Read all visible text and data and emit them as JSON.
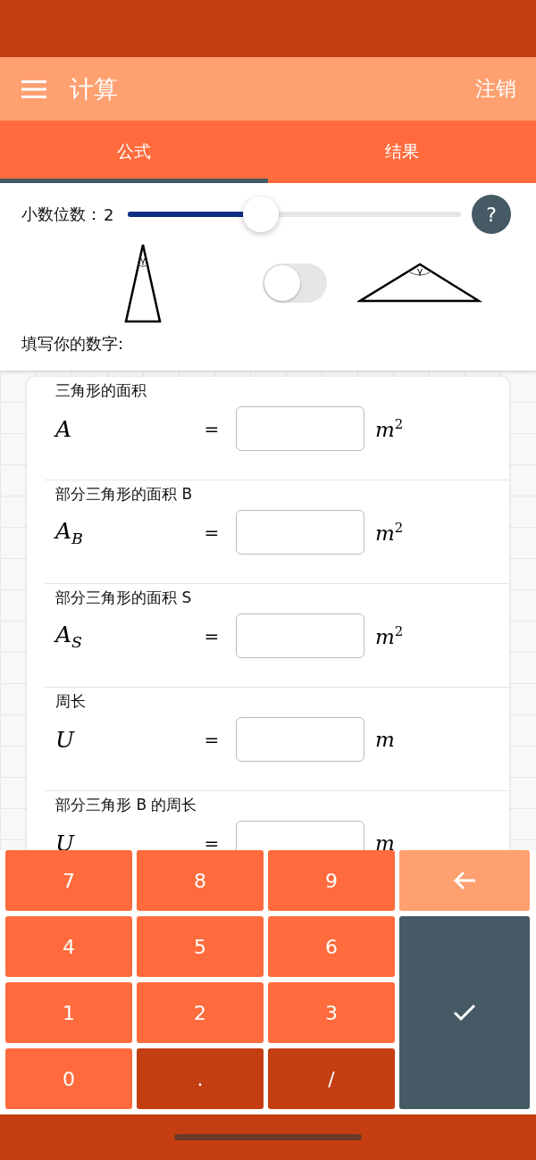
{
  "app_bar": {
    "title": "计算",
    "action": "注销"
  },
  "tabs": [
    {
      "label": "公式",
      "selected": true
    },
    {
      "label": "结果",
      "selected": false
    }
  ],
  "settings": {
    "decimals_label": "小数位数：",
    "decimals_value": "2",
    "slider": {
      "level": 0.4
    },
    "help": "?",
    "triangles": [
      {
        "angle": "γ"
      },
      {
        "angle": "γ"
      }
    ],
    "toggle": {
      "on": false
    },
    "prompt": "填写你的数字:"
  },
  "fields": [
    {
      "label": "三角形的面积",
      "symbol": "A",
      "equals": "=",
      "unit": "m$^{2}$"
    },
    {
      "label": "部分三角形的面积 B",
      "symbol": "A$_{B}$",
      "equals": "=",
      "unit": "m$^{2}$"
    },
    {
      "label": "部分三角形的面积 S",
      "symbol": "A$_{S}$",
      "equals": "=",
      "unit": "m$^{2}$"
    },
    {
      "label": "周长",
      "symbol": "U",
      "equals": "=",
      "unit": "m"
    },
    {
      "label": "部分三角形 B 的周长",
      "symbol": "U",
      "equals": "=",
      "unit": "m"
    }
  ],
  "keypad": [
    {
      "kind": "digit",
      "label": "7"
    },
    {
      "kind": "digit",
      "label": "8"
    },
    {
      "kind": "digit",
      "label": "9"
    },
    {
      "kind": "back"
    },
    {
      "kind": "digit",
      "label": "4"
    },
    {
      "kind": "digit",
      "label": "5"
    },
    {
      "kind": "digit",
      "label": "6"
    },
    {
      "kind": "enter"
    },
    {
      "kind": "digit",
      "label": "1"
    },
    {
      "kind": "digit",
      "label": "2"
    },
    {
      "kind": "digit",
      "label": "3"
    },
    {
      "kind": "digit",
      "label": "0"
    },
    {
      "kind": "symbol",
      "label": "."
    },
    {
      "kind": "symbol",
      "label": "/"
    }
  ]
}
